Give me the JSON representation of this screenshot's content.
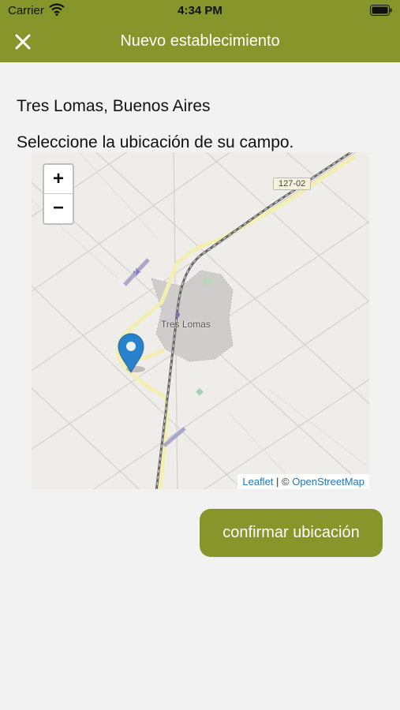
{
  "status_bar": {
    "carrier": "Carrier",
    "time": "4:34 PM"
  },
  "nav": {
    "title": "Nuevo establecimiento",
    "close_icon": "close-icon"
  },
  "content": {
    "location": "Tres Lomas, Buenos Aires",
    "instruction": "Seleccione la ubicación de su campo."
  },
  "map": {
    "zoom_in": "+",
    "zoom_out": "−",
    "town_label": "Tres Lomas",
    "road_label": "127-02",
    "attribution": {
      "leaflet": "Leaflet",
      "separator": " | © ",
      "osm": "OpenStreetMap"
    },
    "marker_color": "#2a81cb"
  },
  "actions": {
    "confirm_label": "confirmar ubicación"
  },
  "colors": {
    "brand": "#86962a",
    "background": "#f2f2f2"
  }
}
